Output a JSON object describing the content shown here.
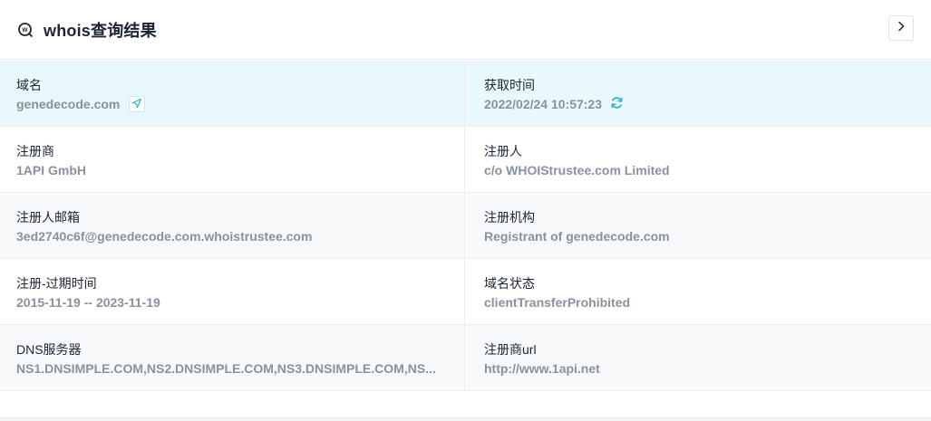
{
  "header": {
    "title": "whois查询结果",
    "logo_icon": "whois-logo-icon",
    "expand_icon": "chevron-right-icon"
  },
  "colors": {
    "accent": "#1fb4c8",
    "highlight_row": "#e9f8fc",
    "label_text": "#1d2433",
    "value_text": "#8a919e"
  },
  "rows": [
    {
      "left": {
        "label": "域名",
        "value": "genedecode.com",
        "icon": "send-icon"
      },
      "right": {
        "label": "获取时间",
        "value": "2022/02/24 10:57:23",
        "icon": "refresh-icon"
      }
    },
    {
      "left": {
        "label": "注册商",
        "value": "1API GmbH"
      },
      "right": {
        "label": "注册人",
        "value": "c/o WHOIStrustee.com Limited"
      }
    },
    {
      "left": {
        "label": "注册人邮箱",
        "value": "3ed2740c6f@genedecode.com.whoistrustee.com"
      },
      "right": {
        "label": "注册机构",
        "value": "Registrant of genedecode.com"
      }
    },
    {
      "left": {
        "label": "注册-过期时间",
        "value": "2015-11-19 -- 2023-11-19"
      },
      "right": {
        "label": "域名状态",
        "value": "clientTransferProhibited"
      }
    },
    {
      "left": {
        "label": "DNS服务器",
        "value": "NS1.DNSIMPLE.COM,NS2.DNSIMPLE.COM,NS3.DNSIMPLE.COM,NS..."
      },
      "right": {
        "label": "注册商url",
        "value": "http://www.1api.net"
      }
    }
  ]
}
